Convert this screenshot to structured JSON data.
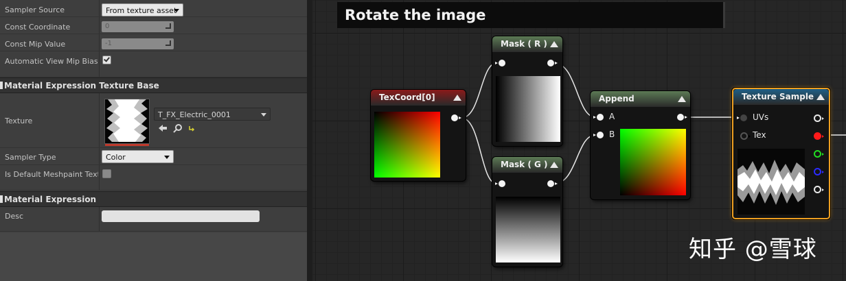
{
  "details": {
    "rows_top": [
      {
        "label": "Sampler Source",
        "value": "From texture asset"
      },
      {
        "label": "Const Coordinate",
        "value": "0"
      },
      {
        "label": "Const Mip Value",
        "value": "-1"
      },
      {
        "label": "Automatic View Mip Bias",
        "checked": true
      }
    ],
    "categories": [
      {
        "title": "Material Expression Texture Base"
      },
      {
        "title": "Material Expression"
      }
    ],
    "texture": {
      "label": "Texture",
      "asset_name": "T_FX_Electric_0001",
      "accent": "#c0392b"
    },
    "sampler_type": {
      "label": "Sampler Type",
      "value": "Color"
    },
    "meshpaint": {
      "label": "Is Default Meshpaint Textu",
      "checked": false
    },
    "desc": {
      "label": "Desc",
      "value": ""
    }
  },
  "graph": {
    "comment_title": "Rotate the image",
    "nodes": {
      "texcoord": {
        "title": "TexCoord[0]",
        "header_color": "#8b1a1a"
      },
      "mask_r": {
        "title": "Mask ( R )",
        "header_color": "#5c7a55"
      },
      "mask_g": {
        "title": "Mask ( G )",
        "header_color": "#5c7a55"
      },
      "append": {
        "title": "Append",
        "header_color": "#5c7a55"
      },
      "texture_sample": {
        "title": "Texture Sample",
        "header_color": "#1f5f86",
        "inputs": [
          "UVs",
          "Tex"
        ]
      }
    },
    "append_inputs": [
      "A",
      "B"
    ],
    "output_pin_colors": [
      "#ffffff",
      "#ff1a1a",
      "#22dd22",
      "#2b2bff",
      "#ffffff"
    ]
  },
  "watermark": "知乎 @雪球"
}
